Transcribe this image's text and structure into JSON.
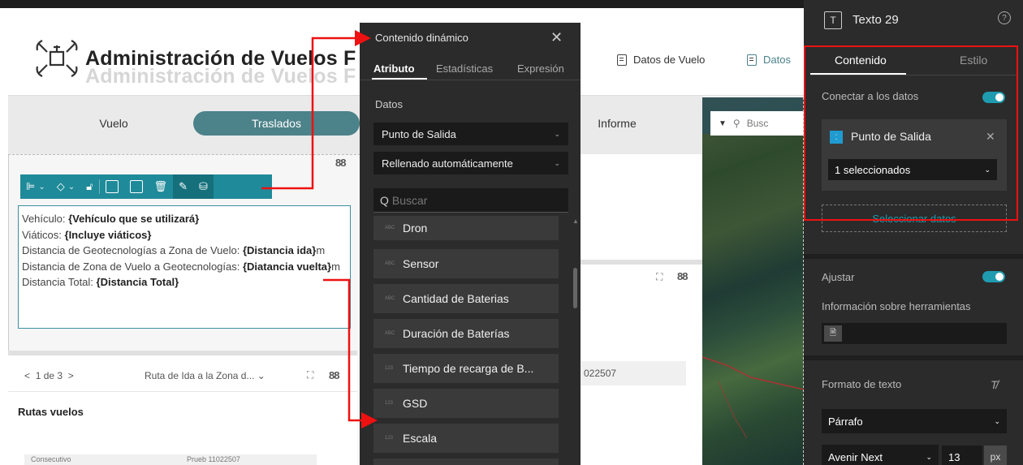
{
  "app": {
    "title": "Administración de Vuelos F",
    "header_links": [
      "Datos de Vuelo",
      "Datos"
    ]
  },
  "nav": {
    "tabs": [
      {
        "label": "Vuelo",
        "active": false
      },
      {
        "label": "Traslados",
        "active": true
      },
      {
        "label": "Informe",
        "active": false
      }
    ]
  },
  "text_widget": {
    "lines": [
      {
        "label": "Vehículo: ",
        "value": "{Vehículo que se utilizará}",
        "suffix": ""
      },
      {
        "label": "Viáticos: ",
        "value": "{Incluye viáticos}",
        "suffix": ""
      },
      {
        "label": "Distancia de Geotecnologías a Zona de Vuelo: ",
        "value": "{Distancia ida}",
        "suffix": "m"
      },
      {
        "label": "Distancia de Zona de Vuelo a Geotecnologías: ",
        "value": "{Diatancia vuelta}",
        "suffix": "m"
      },
      {
        "label": "Distancia Total: ",
        "value": "{Distancia Total}",
        "suffix": ""
      }
    ]
  },
  "list_widget": {
    "pager": "1 de 3",
    "route_select": "Ruta de Ida a la Zona d...",
    "title": "Rutas vuelos",
    "table_frag": [
      "Consecutivo",
      "Prueb 11022507"
    ],
    "mid_value": "022507"
  },
  "map": {
    "search_placeholder": "Busc"
  },
  "dynamic_panel": {
    "title": "Contenido dinámico",
    "tabs": [
      "Atributo",
      "Estadísticas",
      "Expresión"
    ],
    "section_label": "Datos",
    "source_select": "Punto de Salida",
    "mode_select": "Rellenado automáticamente",
    "search_placeholder": "Buscar",
    "attributes": [
      {
        "type": "ABC",
        "name": "Dron"
      },
      {
        "type": "ABC",
        "name": "Sensor"
      },
      {
        "type": "ABC",
        "name": "Cantidad de Baterias"
      },
      {
        "type": "ABC",
        "name": "Duración de Baterías"
      },
      {
        "type": "123",
        "name": "Tiempo de recarga de B..."
      },
      {
        "type": "123",
        "name": "GSD"
      },
      {
        "type": "123",
        "name": "Escala"
      }
    ]
  },
  "settings_panel": {
    "title": "Texto 29",
    "tabs": [
      "Contenido",
      "Estilo"
    ],
    "connect_label": "Conectar a los datos",
    "connect_on": true,
    "data_source": "Punto de Salida",
    "selection": "1 seleccionados",
    "select_data": "Seleccionar datos",
    "fit_label": "Ajustar",
    "fit_on": true,
    "tooltip_label": "Información sobre herramientas",
    "text_format_label": "Formato de texto",
    "paragraph": "Párrafo",
    "font": "Avenir Next",
    "font_size": "13",
    "unit": "px"
  },
  "colors": {
    "accent": "#1f8a99",
    "tab_active": "#4c8289",
    "highlight": "#ee1111",
    "panel_bg": "#2b2b2b"
  }
}
